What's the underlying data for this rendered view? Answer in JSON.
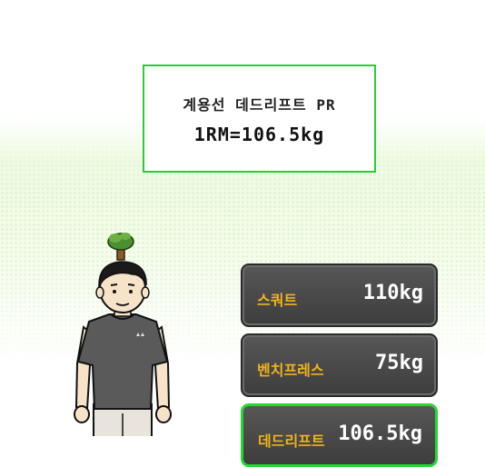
{
  "pr_card": {
    "title": "계용선 데드리프트 PR",
    "value": "1RM=106.5kg"
  },
  "stats": [
    {
      "label": "스쿼트",
      "value": "110kg",
      "active": false
    },
    {
      "label": "벤치프레스",
      "value": "75kg",
      "active": false
    },
    {
      "label": "데드리프트",
      "value": "106.5kg",
      "active": true
    }
  ],
  "colors": {
    "accent_green": "#2bcc35",
    "label_gold": "#f0b21b",
    "card_dark": "#484848"
  },
  "icons": [
    "tree-icon"
  ]
}
